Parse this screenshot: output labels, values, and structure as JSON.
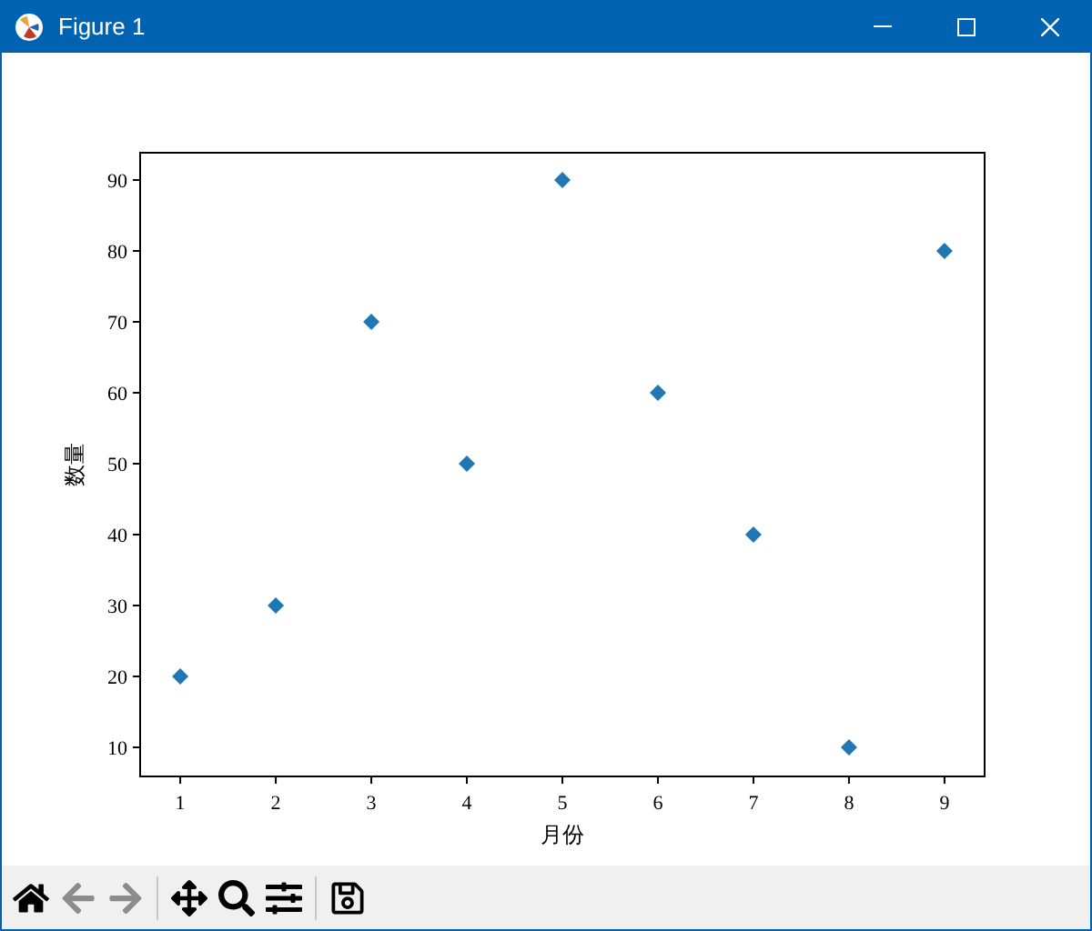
{
  "window": {
    "title": "Figure 1"
  },
  "figure": {
    "chart_data": {
      "type": "scatter",
      "xlabel": "月份",
      "ylabel": "数量",
      "x": [
        1,
        2,
        3,
        4,
        5,
        6,
        7,
        8,
        9
      ],
      "series": [
        {
          "color": "#1f77b4",
          "values": [
            20,
            30,
            70,
            50,
            90,
            60,
            40,
            10,
            80
          ]
        }
      ],
      "xlim": [
        0.58,
        9.42
      ],
      "ylim": [
        5.9,
        93.85
      ],
      "xticks": [
        1,
        2,
        3,
        4,
        5,
        6,
        7,
        8,
        9
      ],
      "yticks": [
        10,
        20,
        30,
        40,
        50,
        60,
        70,
        80,
        90
      ]
    }
  },
  "toolbar": [
    {
      "kind": "home",
      "disabled": false
    },
    {
      "kind": "back",
      "disabled": true
    },
    {
      "kind": "forward",
      "disabled": true
    },
    {
      "kind": "separator"
    },
    {
      "kind": "pan",
      "disabled": false
    },
    {
      "kind": "zoom",
      "disabled": false
    },
    {
      "kind": "configure",
      "disabled": false
    },
    {
      "kind": "separator"
    },
    {
      "kind": "save",
      "disabled": false
    }
  ]
}
